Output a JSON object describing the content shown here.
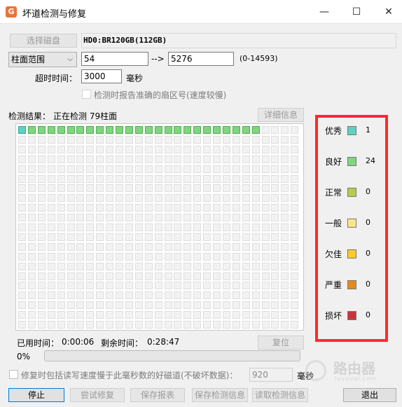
{
  "window": {
    "title": "坏道检测与修复",
    "app_icon_glyph": "G",
    "minimize_glyph": "—",
    "maximize_glyph": "☐",
    "close_glyph": "✕"
  },
  "disk": {
    "select_label": "选择磁盘",
    "name": "HD0:BR120GB(112GB)"
  },
  "range": {
    "mode": "柱面范围",
    "start": "54",
    "arrow": "-->",
    "end": "5276",
    "limit": "(0-14593)"
  },
  "timeout": {
    "label": "超时时间：",
    "value": "3000",
    "unit": "毫秒"
  },
  "report_sector_checkbox": "检测时报告准确的扇区号(速度较慢)",
  "result": {
    "label": "检测结果：",
    "status": "正在检测 79柱面",
    "details_button": "详细信息"
  },
  "grid": {
    "columns": 29,
    "rows": 21,
    "excellent_cells": 1,
    "good_cells": 24
  },
  "legend": [
    {
      "label": "优秀",
      "color": "#5fd1c0",
      "count": "1"
    },
    {
      "label": "良好",
      "color": "#7fd67f",
      "count": "24"
    },
    {
      "label": "正常",
      "color": "#b5cc4c",
      "count": "0"
    },
    {
      "label": "一般",
      "color": "#ffe58a",
      "count": "0"
    },
    {
      "label": "欠佳",
      "color": "#ffca2c",
      "count": "0"
    },
    {
      "label": "严重",
      "color": "#e58a1a",
      "count": "0"
    },
    {
      "label": "损坏",
      "color": "#c8343c",
      "count": "0"
    }
  ],
  "time": {
    "elapsed_label": "已用时间：",
    "elapsed": "0:00:06",
    "remaining_label": "剩余时间：",
    "remaining": "0:28:47",
    "reset_button": "复位"
  },
  "progress": {
    "text": "0%",
    "value": 0
  },
  "repair_option": {
    "label": "修复时包括读写速度慢于此毫秒数的好磁道(不破坏数据)：",
    "value": "920",
    "unit": "毫秒"
  },
  "buttons": {
    "stop": "停止",
    "try_repair": "尝试修复",
    "save_report": "保存报表",
    "save_detect": "保存检测信息",
    "read_detect": "读取检测信息",
    "exit": "退出"
  },
  "watermark": {
    "text": "路由器",
    "sub": "luyouqi.com"
  }
}
